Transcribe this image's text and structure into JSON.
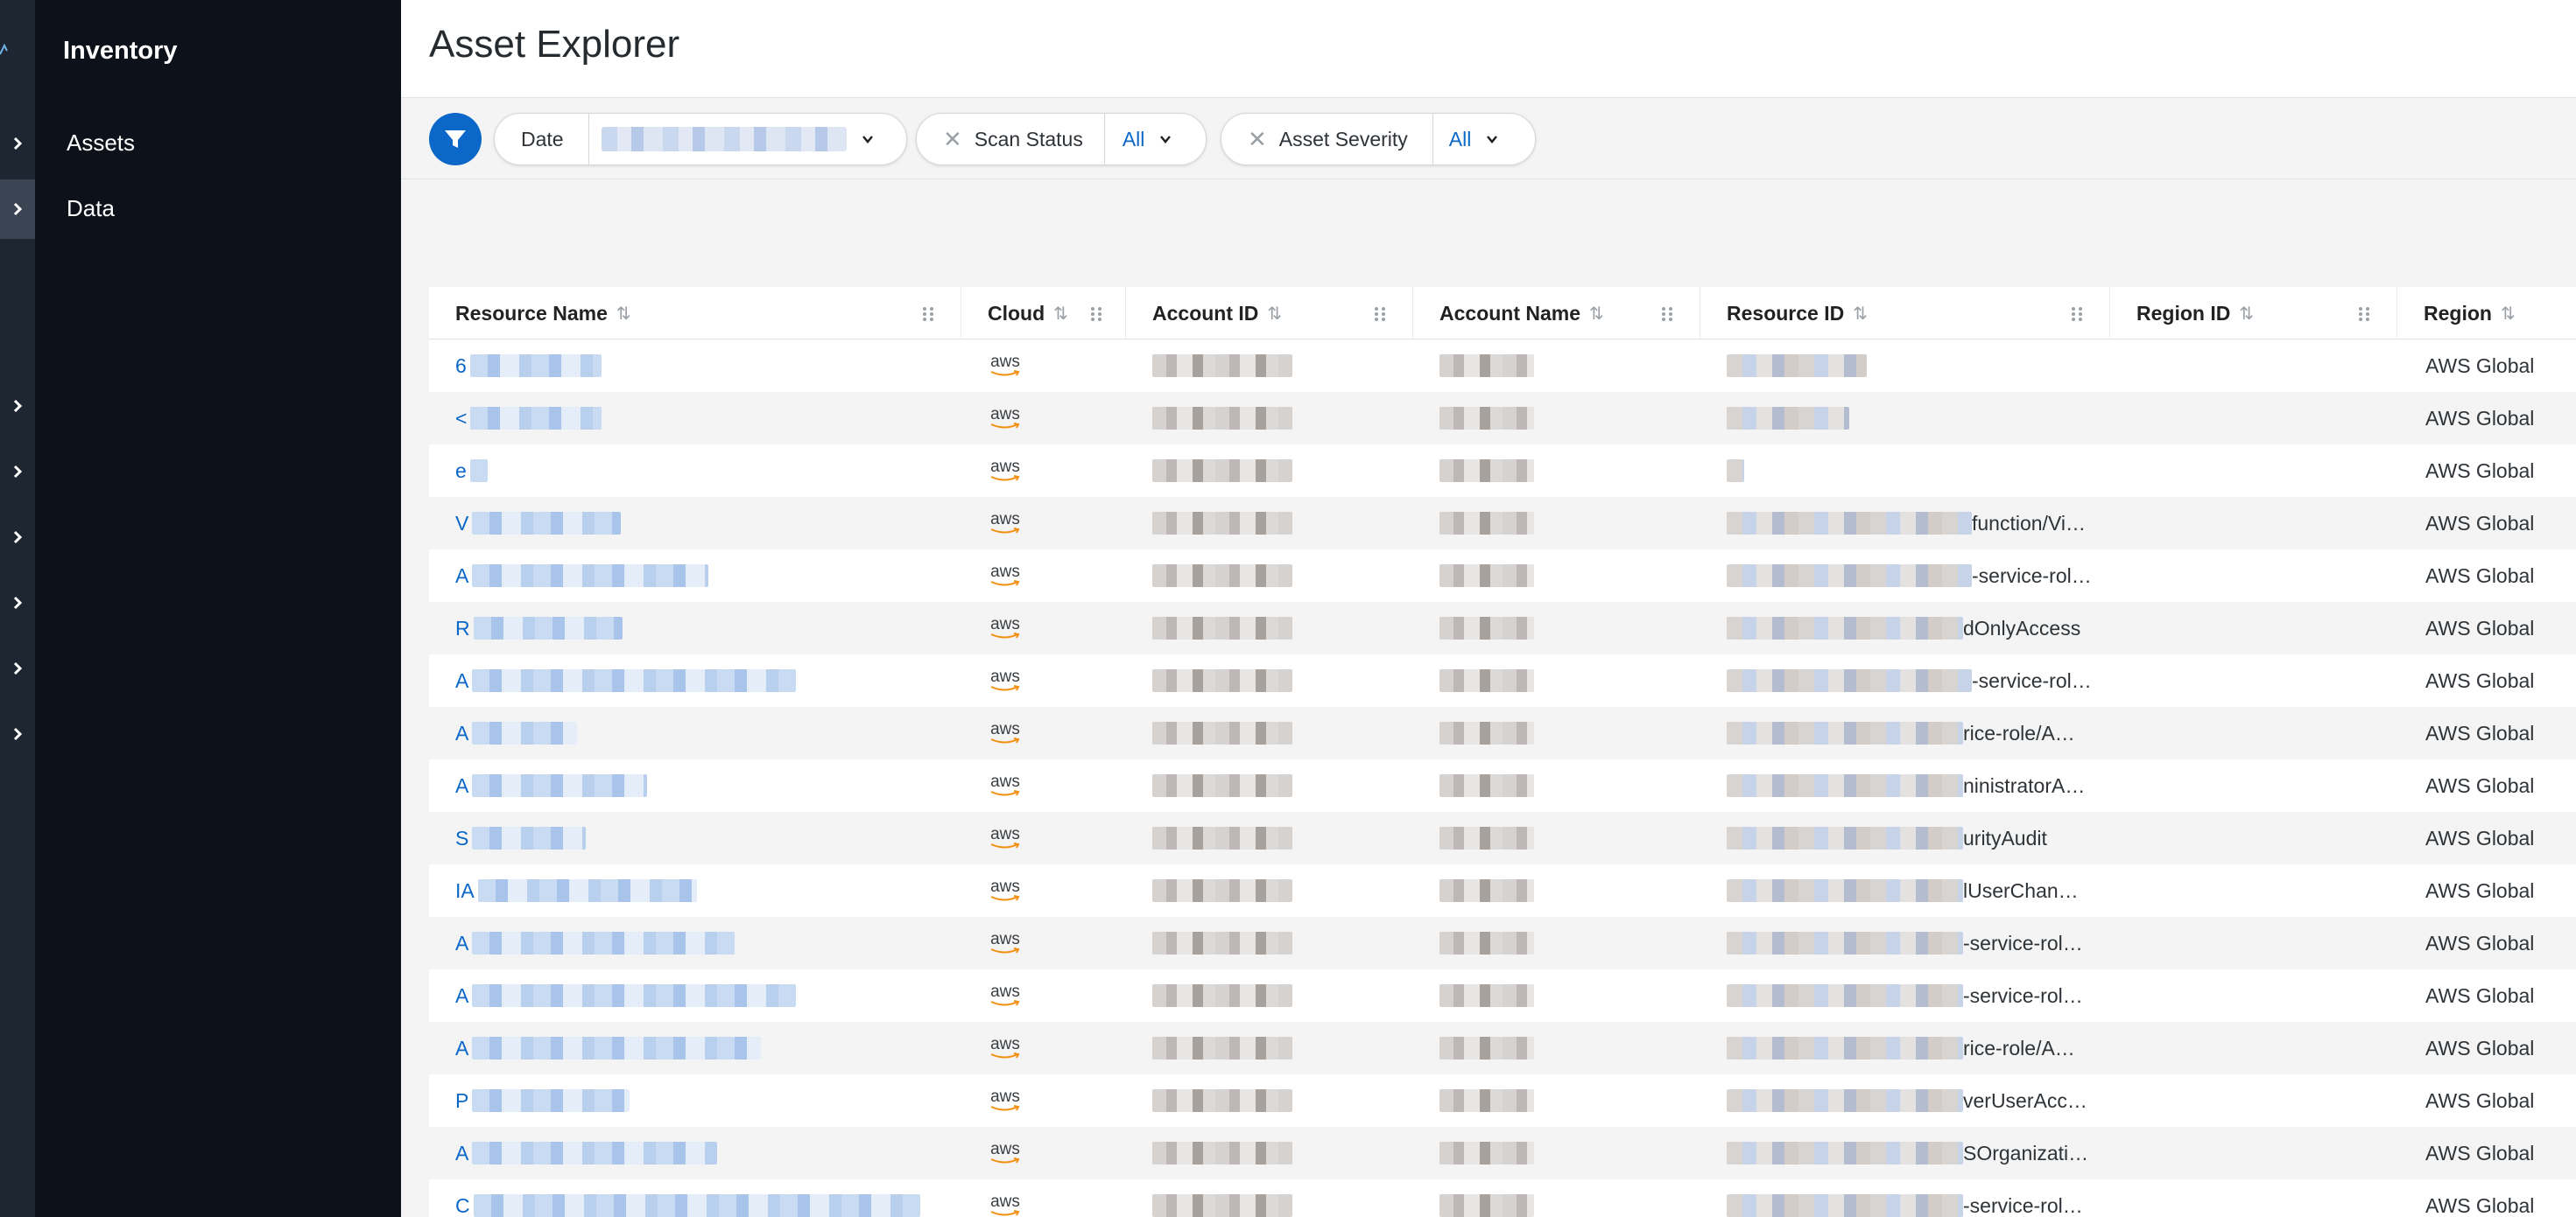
{
  "nav": {
    "title": "Inventory",
    "links": [
      {
        "label": "Assets"
      },
      {
        "label": "Data"
      }
    ]
  },
  "page": {
    "title": "Asset Explorer"
  },
  "filters": {
    "date_label": "Date",
    "scan_status_label": "Scan Status",
    "scan_status_value": "All",
    "asset_severity_label": "Asset Severity",
    "asset_severity_value": "All"
  },
  "table": {
    "columns": [
      "Resource Name",
      "Cloud",
      "Account ID",
      "Account Name",
      "Resource ID",
      "Region ID",
      "Region"
    ],
    "cloud_label": "aws",
    "rows": [
      {
        "name": "6",
        "resource_id": "",
        "region": "AWS Global"
      },
      {
        "name": "<",
        "resource_id": "",
        "region": "AWS Global"
      },
      {
        "name": "e",
        "resource_id": "",
        "region": "AWS Global"
      },
      {
        "name": "V",
        "resource_id": "function/Vi…",
        "region": "AWS Global"
      },
      {
        "name": "A",
        "resource_id": "-service-rol…",
        "region": "AWS Global"
      },
      {
        "name": "R",
        "resource_id": "dOnlyAccess",
        "region": "AWS Global"
      },
      {
        "name": "A",
        "resource_id": "-service-rol…",
        "region": "AWS Global"
      },
      {
        "name": "A",
        "resource_id": "rice-role/A…",
        "region": "AWS Global"
      },
      {
        "name": "A",
        "resource_id": "ninistratorA…",
        "region": "AWS Global"
      },
      {
        "name": "S",
        "resource_id": "urityAudit",
        "region": "AWS Global"
      },
      {
        "name": "IA",
        "resource_id": "lUserChan…",
        "region": "AWS Global"
      },
      {
        "name": "A",
        "resource_id": "-service-rol…",
        "region": "AWS Global"
      },
      {
        "name": "A",
        "resource_id": "-service-rol…",
        "region": "AWS Global"
      },
      {
        "name": "A",
        "resource_id": "rice-role/A…",
        "region": "AWS Global"
      },
      {
        "name": "P",
        "resource_id": "verUserAcc…",
        "region": "AWS Global"
      },
      {
        "name": "A",
        "resource_id": "SOrganizati…",
        "region": "AWS Global"
      },
      {
        "name": "C",
        "resource_id": "-service-rol…",
        "region": "AWS Global"
      }
    ]
  },
  "colors": {
    "accent": "#0b67c8",
    "sidebar": "#0d121a",
    "rail": "#1e2632"
  }
}
